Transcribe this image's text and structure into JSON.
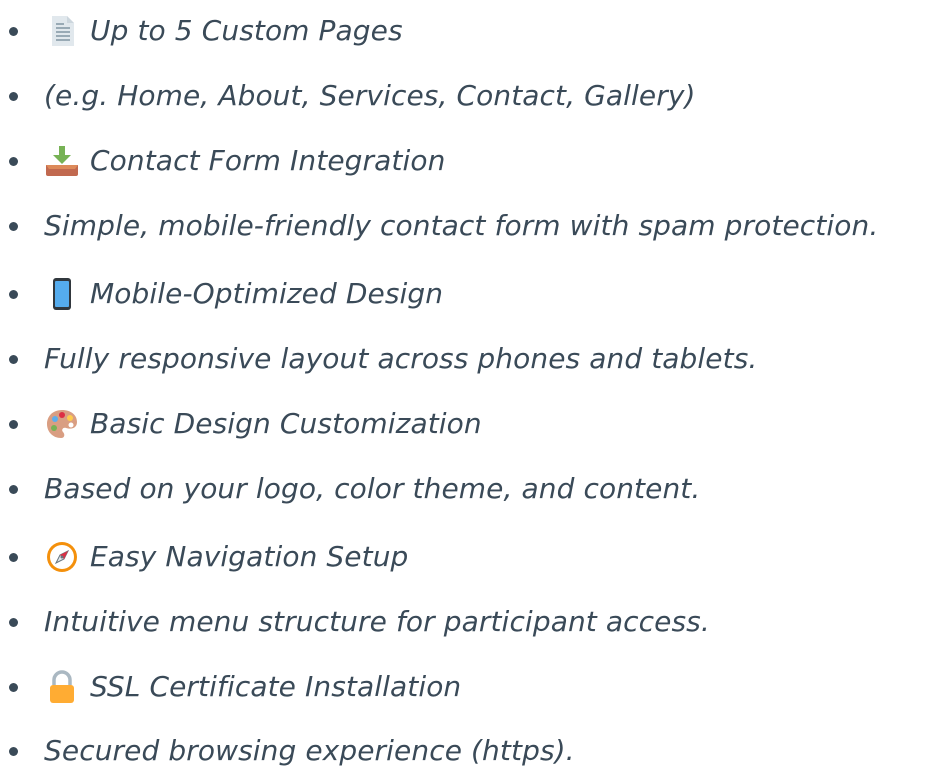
{
  "features": [
    {
      "icon": "page-icon",
      "text": "Up to 5 Custom Pages"
    },
    {
      "icon": "",
      "text": "(e.g. Home, About, Services, Contact, Gallery)"
    },
    {
      "icon": "inbox-download-icon",
      "text": "Contact Form Integration"
    },
    {
      "icon": "",
      "text": "Simple, mobile-friendly contact form with spam protection."
    },
    {
      "icon": "mobile-phone-icon",
      "text": "Mobile-Optimized Design"
    },
    {
      "icon": "",
      "text": "Fully responsive layout across phones and tablets."
    },
    {
      "icon": "artist-palette-icon",
      "text": "Basic Design Customization"
    },
    {
      "icon": "",
      "text": "Based on your logo, color theme, and content."
    },
    {
      "icon": "compass-icon",
      "text": "Easy Navigation Setup"
    },
    {
      "icon": "",
      "text": "Intuitive menu structure for participant access."
    },
    {
      "icon": "lock-icon",
      "text": "SSL Certificate Installation"
    },
    {
      "icon": "",
      "text": "Secured browsing experience (https)."
    }
  ],
  "colors": {
    "text": "#3a4a58",
    "background": "#ffffff"
  }
}
